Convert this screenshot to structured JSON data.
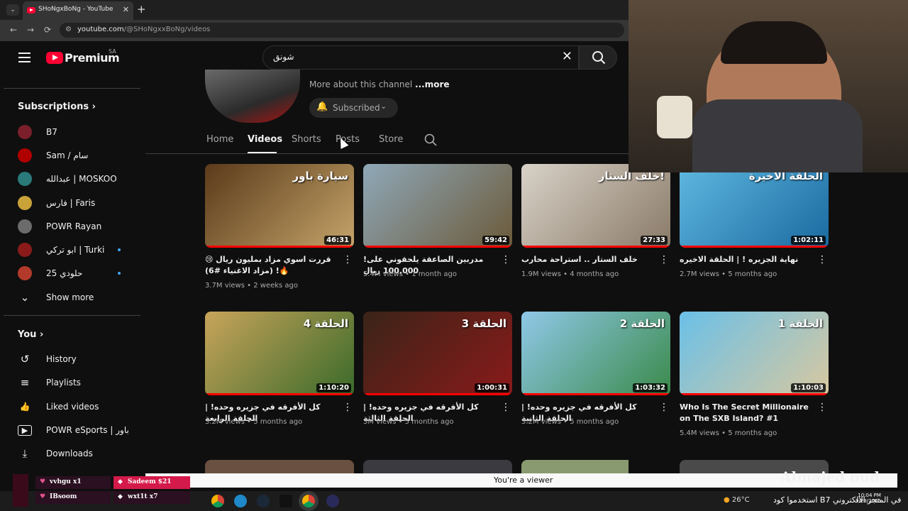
{
  "browser": {
    "tab_title": "SHoNgxBoNg - YouTube",
    "close_glyph": "✕",
    "newtab_glyph": "+",
    "url_host": "youtube.com",
    "url_path": "/@SHoNgxxBoNg/videos",
    "nav": {
      "back": "←",
      "forward": "→",
      "reload": "⟳"
    }
  },
  "header": {
    "logo_text": "Premium",
    "region": "SA",
    "search_query": "شونق",
    "clear_glyph": "✕"
  },
  "sidebar": {
    "subscriptions_title": "Subscriptions",
    "subscriptions": [
      {
        "label": "B7",
        "color": "#7a1f2b",
        "new": false
      },
      {
        "label": "Sam / سام",
        "color": "#b00000",
        "new": false
      },
      {
        "label": "عبدالله | MOSKOO",
        "color": "#2a7a7a",
        "new": false
      },
      {
        "label": "فارس | Faris",
        "color": "#c9a23a",
        "new": false
      },
      {
        "label": "POWR Rayan",
        "color": "#6b6b6b",
        "new": false
      },
      {
        "label": "ابو تركي | Turki",
        "color": "#8b1a1a",
        "new": true
      },
      {
        "label": "حلودي 25",
        "color": "#b33a2a",
        "new": true
      }
    ],
    "show_more": "Show more",
    "you_title": "You",
    "you_items": [
      {
        "label": "History",
        "icon": "history-icon",
        "glyph": "↺"
      },
      {
        "label": "Playlists",
        "icon": "playlists-icon",
        "glyph": "≡"
      },
      {
        "label": "Liked videos",
        "icon": "thumbs-up-icon",
        "glyph": "👍"
      },
      {
        "label": "POWR eSports | باور",
        "icon": "play-square-icon",
        "glyph": "▶"
      },
      {
        "label": "Downloads",
        "icon": "download-icon",
        "glyph": "⤓"
      }
    ]
  },
  "channel": {
    "more_about": "More about this channel",
    "more_link": "...more",
    "subscribed": "Subscribed",
    "tabs": [
      "Home",
      "Videos",
      "Shorts",
      "Posts",
      "Store"
    ]
  },
  "videos": [
    {
      "title": "قررت اسوي مزاد بمليون ريال 😢🔥! (مزاد الاغنياء #6)",
      "views": "3.7M views",
      "age": "2 weeks ago",
      "duration": "46:31",
      "thumb_text": "سيارة باور",
      "c1": "#5a3a1a",
      "c2": "#c5a46a"
    },
    {
      "title": "!مدربين الصاعقة يلحقوني على 100,000 ريال",
      "views": "5.4M views",
      "age": "1 month ago",
      "duration": "59:42",
      "thumb_text": "",
      "c1": "#8fa8b8",
      "c2": "#6b5a3a"
    },
    {
      "title": "خلف الستار .. استراحة محارب",
      "views": "1.9M views",
      "age": "4 months ago",
      "duration": "27:33",
      "thumb_text": "خلف الستار!",
      "c1": "#d8d2c8",
      "c2": "#8a7a68"
    },
    {
      "title": "نهاية الجزيره ! | الحلقة الاخيره",
      "views": "2.7M views",
      "age": "5 months ago",
      "duration": "1:02:11",
      "thumb_text": "الحلقة الاخيرة",
      "c1": "#5fb8e0",
      "c2": "#1a6aa0"
    },
    {
      "title": "كل الأفرقه في جزيره وحده! | الحلقة الرابعة",
      "views": "3.2M views",
      "age": "5 months ago",
      "duration": "1:10:20",
      "thumb_text": "الحلقة 4",
      "c1": "#c8a45a",
      "c2": "#3a6a2a"
    },
    {
      "title": "كل الأفرقه في جزيره وحده! | الحلقة الثالثة",
      "views": "3M views",
      "age": "5 months ago",
      "duration": "1:00:31",
      "thumb_text": "الحلقة 3",
      "c1": "#3a2418",
      "c2": "#8a1a1a"
    },
    {
      "title": "كل الأفرقه في جزيره وحده! | الحلقة الثانية",
      "views": "3.2M views",
      "age": "5 months ago",
      "duration": "1:03:32",
      "thumb_text": "الحلقة 2",
      "c1": "#8fc8e8",
      "c2": "#3a8a4a"
    },
    {
      "title": "Who Is The Secret Millionaire on The SXB Island? #1",
      "views": "5.4M views",
      "age": "5 months ago",
      "duration": "1:10:03",
      "thumb_text": "الحلقة 1",
      "c1": "#6ac0e8",
      "c2": "#d8c8a0"
    }
  ],
  "viewer_bar": "You're a viewer",
  "chat": [
    {
      "user": "vvhgu x1"
    },
    {
      "user": "IBsoom"
    },
    {
      "user": "Sadeem $21"
    },
    {
      "user": "wxt1t x7"
    }
  ],
  "tray": {
    "temp": "26°C"
  },
  "ticker": "استخدموا كود B7 في المتجر الالكتروني",
  "overlay_text": "Almajed oud",
  "clock": {
    "time": "10:04 PM",
    "date": "9/29/2025"
  }
}
